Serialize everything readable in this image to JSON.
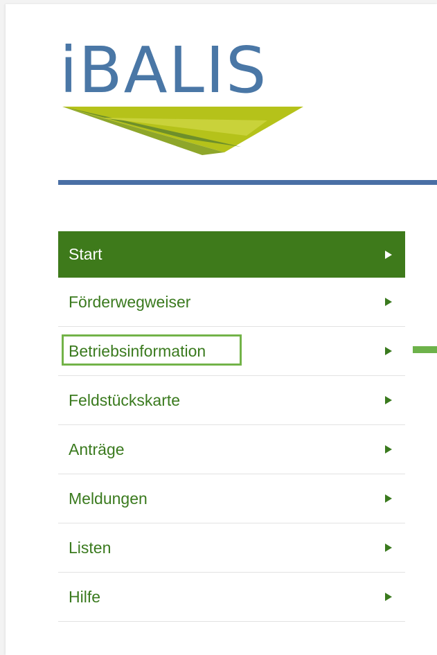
{
  "logo": {
    "text": "iBALIS",
    "colors": {
      "letters": "#4a77a6",
      "swoosh_light": "#b5c21a",
      "swoosh_dark": "#6e8f2a"
    }
  },
  "colors": {
    "rule": "#4a6fa5",
    "nav_active_bg": "#3e7a1b",
    "nav_text": "#3a7a1e",
    "highlight": "#72b348"
  },
  "nav": {
    "items": [
      {
        "label": "Start",
        "active": true
      },
      {
        "label": "Förderwegweiser"
      },
      {
        "label": "Betriebsinformation",
        "highlighted": true
      },
      {
        "label": "Feldstückskarte"
      },
      {
        "label": "Anträge"
      },
      {
        "label": "Meldungen"
      },
      {
        "label": "Listen"
      },
      {
        "label": "Hilfe"
      }
    ],
    "arrow_icon": "triangle-right-icon"
  },
  "annotation": {
    "pointer_icon": "green-pointer-bar"
  }
}
